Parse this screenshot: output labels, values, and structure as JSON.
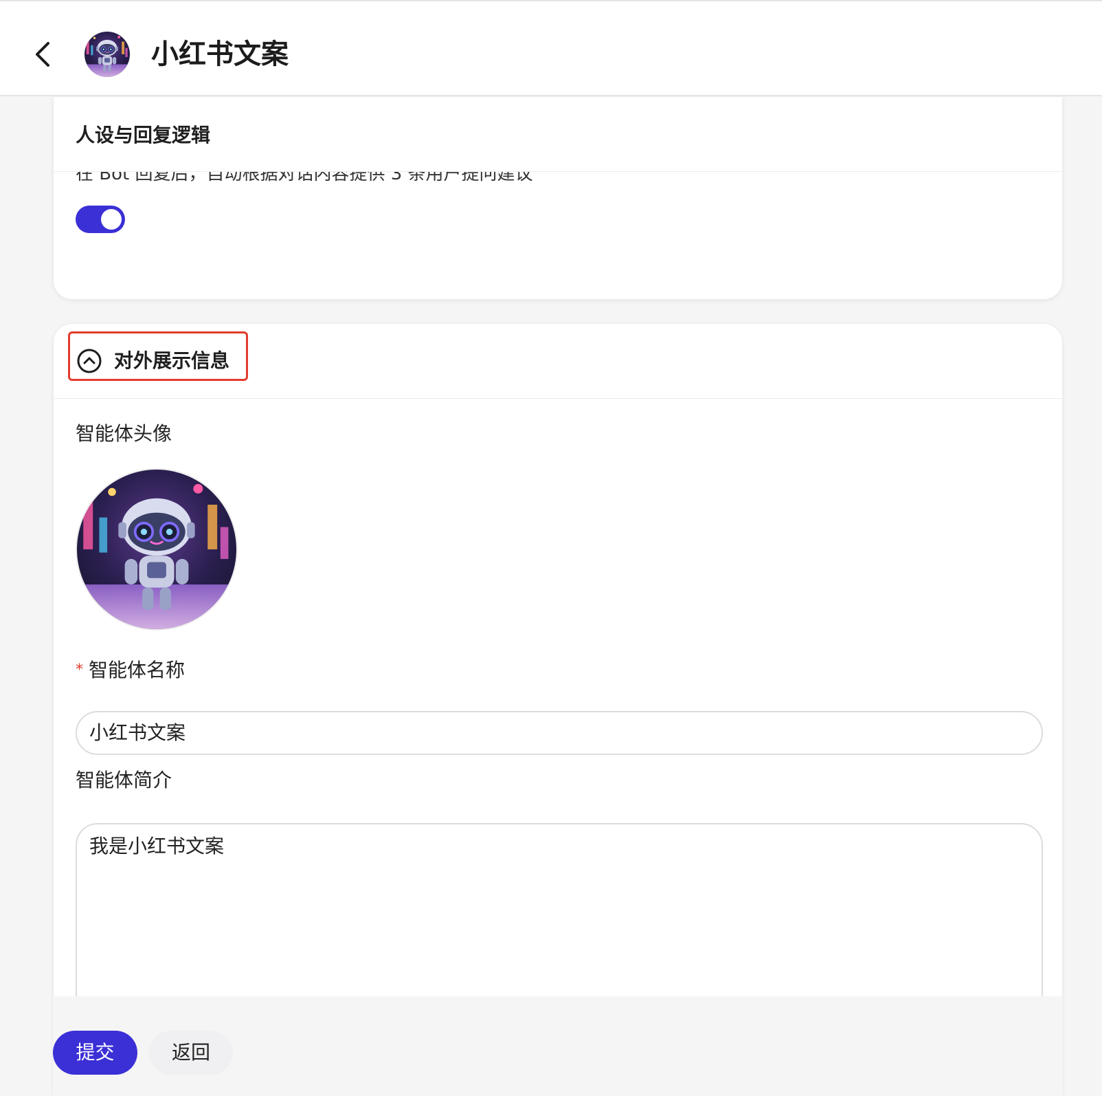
{
  "header": {
    "title": "小红书文案",
    "back_icon": "chevron-left-icon",
    "avatar": "robot-avatar"
  },
  "persona_section": {
    "title": "人设与回复逻辑",
    "clipped_description": "在 Bot 回复后，自动根据对话内容提供 3 条用户提问建议",
    "toggle_on": true
  },
  "display_section": {
    "title": "对外展示信息",
    "toggle_icon": "chevron-up-circle-icon",
    "avatar_label": "智能体头像",
    "name_label": "智能体名称",
    "name_required_mark": "*",
    "name_value": "小红书文案",
    "intro_label": "智能体简介",
    "intro_value": "我是小红书文案"
  },
  "footer": {
    "submit_label": "提交",
    "back_label": "返回"
  },
  "colors": {
    "accent": "#3b2fd6",
    "highlight_border": "#e23b2b",
    "required": "#e23b2b"
  }
}
